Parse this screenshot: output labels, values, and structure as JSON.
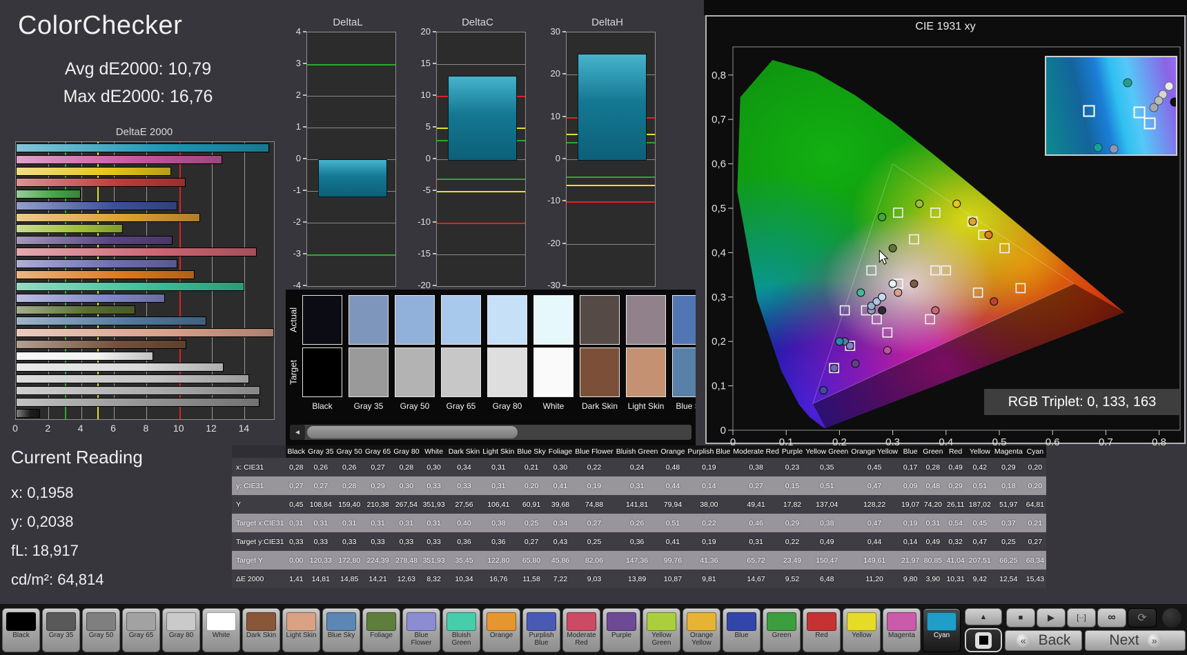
{
  "header": {
    "title": "ColorChecker",
    "avg_label": "Avg dE2000: 10,79",
    "max_label": "Max dE2000: 16,76"
  },
  "current_reading": {
    "title": "Current Reading",
    "x": "x: 0,1958",
    "y": "y: 0,2038",
    "fl": "fL: 18,917",
    "cd": "cd/m²: 64,814"
  },
  "patches": [
    {
      "name": "Black",
      "color": "#000000",
      "bar": "#1c1c1c",
      "dot": "#23232b"
    },
    {
      "name": "Gray 35",
      "color": "#595959",
      "bar": "#8f8f8f",
      "dot": "#8b9db8"
    },
    {
      "name": "Gray 50",
      "color": "#7f7f7f",
      "bar": "#a9a9a9",
      "dot": "#9db4d4"
    },
    {
      "name": "Gray 65",
      "color": "#a2a2a2",
      "bar": "#c2c2c2",
      "dot": "#b0c9e4"
    },
    {
      "name": "Gray 80",
      "color": "#cacaca",
      "bar": "#dbdbdb",
      "dot": "#c8e0f4"
    },
    {
      "name": "White",
      "color": "#ffffff",
      "bar": "#f2f2f2",
      "dot": "#e8f6fa"
    },
    {
      "name": "Dark Skin",
      "color": "#8a5638",
      "bar": "#74503a"
    },
    {
      "name": "Light Skin",
      "color": "#dba183",
      "bar": "#d7a089"
    },
    {
      "name": "Blue Sky",
      "color": "#5c86b4",
      "bar": "#50789c"
    },
    {
      "name": "Foliage",
      "color": "#5e7e3c",
      "bar": "#5a6e32"
    },
    {
      "name": "Blue Flower",
      "color": "#8c8cd2",
      "bar": "#8288c8"
    },
    {
      "name": "Bluish Green",
      "color": "#46ceaa",
      "bar": "#3cbe96"
    },
    {
      "name": "Orange",
      "color": "#e6962e",
      "bar": "#dc781e"
    },
    {
      "name": "Purplish Blue",
      "color": "#4a5ab4",
      "bar": "#6e6eb4"
    },
    {
      "name": "Moderate Red",
      "color": "#cc4a64",
      "bar": "#cc6472"
    },
    {
      "name": "Purple",
      "color": "#6e4a96",
      "bar": "#5a4682"
    },
    {
      "name": "Yellow Green",
      "color": "#aace3c",
      "bar": "#a0be3c"
    },
    {
      "name": "Orange Yellow",
      "color": "#e6b432",
      "bar": "#dc9e32"
    },
    {
      "name": "Blue",
      "color": "#3246aa",
      "bar": "#3c50a0"
    },
    {
      "name": "Green",
      "color": "#3c9e3c",
      "bar": "#46a446"
    },
    {
      "name": "Red",
      "color": "#c63232",
      "bar": "#bc3c3c"
    },
    {
      "name": "Yellow",
      "color": "#e6dc28",
      "bar": "#e6c41e"
    },
    {
      "name": "Magenta",
      "color": "#ca5aaa",
      "bar": "#c4569c"
    },
    {
      "name": "Cyan",
      "color": "#1e9ec8",
      "bar": "#1e96b4"
    }
  ],
  "active_patch": "Cyan",
  "chart_data": [
    {
      "type": "bar",
      "title": "DeltaE 2000",
      "orientation": "horizontal",
      "axis_max": 15.8,
      "x_tick_step": 2,
      "x_tick_max": 14,
      "ref_lines": [
        {
          "value": 3,
          "color": "#2cab2c"
        },
        {
          "value": 5,
          "color": "#e3e32a"
        },
        {
          "value": 10,
          "color": "#e02222"
        }
      ],
      "note": "bars drawn top-to-bottom in reverse patch order (Cyan first, Black last); values from table row dE2000"
    },
    {
      "type": "bar",
      "title": "DeltaL",
      "range": 4,
      "tick_step": 1,
      "bar_from": 0,
      "bar_to": -1.15,
      "ref_lines": [
        {
          "value": 3,
          "color": "#2cab2c"
        },
        {
          "value": -3,
          "color": "#2cab2c"
        }
      ]
    },
    {
      "type": "bar",
      "title": "DeltaC",
      "range": 20,
      "tick_step": 5,
      "bar_from": 0,
      "bar_to": 13.2,
      "ref_lines": [
        {
          "value": 10,
          "color": "#e02222"
        },
        {
          "value": -10,
          "color": "#e02222"
        },
        {
          "value": 5,
          "color": "#e3e32a"
        },
        {
          "value": -5,
          "color": "#e3e32a"
        },
        {
          "value": 3,
          "color": "#2cab2c"
        },
        {
          "value": -3,
          "color": "#2cab2c"
        }
      ]
    },
    {
      "type": "bar",
      "title": "DeltaH",
      "range": 30,
      "tick_step": 10,
      "bar_from": 0,
      "bar_to": 25,
      "ref_lines": [
        {
          "value": 10,
          "color": "#e02222"
        },
        {
          "value": -10,
          "color": "#e02222"
        },
        {
          "value": 6,
          "color": "#e3e32a"
        },
        {
          "value": -6,
          "color": "#e3e32a"
        },
        {
          "value": 4,
          "color": "#2cab2c"
        },
        {
          "value": -4,
          "color": "#2cab2c"
        }
      ]
    }
  ],
  "swatch_viewer": {
    "row_labels": [
      "Actual",
      "Target"
    ],
    "columns": [
      {
        "label": "Black",
        "actual": "#0c0c14",
        "target": "#000000"
      },
      {
        "label": "Gray 35",
        "actual": "#7e96bc",
        "target": "#9a9a9a"
      },
      {
        "label": "Gray 50",
        "actual": "#91b1da",
        "target": "#b3b3b3"
      },
      {
        "label": "Gray 65",
        "actual": "#a8c8ec",
        "target": "#c7c7c7"
      },
      {
        "label": "Gray 80",
        "actual": "#c6e0f8",
        "target": "#dedede"
      },
      {
        "label": "White",
        "actual": "#e6f8fc",
        "target": "#fafafa"
      },
      {
        "label": "Dark Skin",
        "actual": "#564a46",
        "target": "#7c5038"
      },
      {
        "label": "Light Skin",
        "actual": "#91818b",
        "target": "#c49272"
      },
      {
        "label": "Blue Sky",
        "actual": "#5276b4",
        "target": "#5880a8"
      }
    ]
  },
  "cie": {
    "title": "CIE 1931 xy",
    "rgb_triplet": "RGB Triplet: 0, 133, 163",
    "tick_count": 8,
    "cursor_chroma": [
      0.275,
      0.405
    ],
    "inset_squares": [
      [
        0.33,
        0.55
      ],
      [
        0.72,
        0.57
      ],
      [
        0.8,
        0.68
      ]
    ],
    "inset_dots": [
      [
        0.63,
        0.26,
        "#2a9a8a"
      ],
      [
        0.945,
        0.3,
        "#ececec"
      ],
      [
        0.9,
        0.385,
        "#d4d4d4"
      ],
      [
        0.865,
        0.45,
        "#bcbcbc"
      ],
      [
        0.83,
        0.52,
        "#a8a8b2"
      ],
      [
        0.99,
        0.46,
        "#141414"
      ],
      [
        0.4,
        0.93,
        "#18a0a0"
      ],
      [
        0.52,
        0.945,
        "#8898b8"
      ]
    ]
  },
  "table": {
    "rows": [
      {
        "label": "x: CIE31",
        "values": [
          "0,28",
          "0,26",
          "0,26",
          "0,27",
          "0,28",
          "0,30",
          "0,34",
          "0,31",
          "0,21",
          "0,30",
          "0,22",
          "0,24",
          "0,48",
          "0,19",
          "0,38",
          "0,23",
          "0,35",
          "0,45",
          "0,17",
          "0,28",
          "0,49",
          "0,42",
          "0,29",
          "0,20"
        ]
      },
      {
        "label": "y: CIE31",
        "values": [
          "0,27",
          "0,27",
          "0,28",
          "0,29",
          "0,30",
          "0,33",
          "0,33",
          "0,31",
          "0,20",
          "0,41",
          "0,19",
          "0,31",
          "0,44",
          "0,14",
          "0,27",
          "0,15",
          "0,51",
          "0,47",
          "0,09",
          "0,48",
          "0,29",
          "0,51",
          "0,18",
          "0,20"
        ]
      },
      {
        "label": "Y",
        "values": [
          "0,45",
          "108,84",
          "159,40",
          "210,38",
          "267,54",
          "351,93",
          "27,56",
          "106,41",
          "60,91",
          "39,68",
          "74,88",
          "141,81",
          "79,94",
          "38,00",
          "49,41",
          "17,82",
          "137,04",
          "128,22",
          "19,07",
          "74,20",
          "26,11",
          "187,02",
          "51,97",
          "64,81"
        ]
      },
      {
        "label": "Target x:CIE31",
        "values": [
          "0,31",
          "0,31",
          "0,31",
          "0,31",
          "0,31",
          "0,31",
          "0,40",
          "0,38",
          "0,25",
          "0,34",
          "0,27",
          "0,26",
          "0,51",
          "0,22",
          "0,46",
          "0,29",
          "0,38",
          "0,47",
          "0,19",
          "0,31",
          "0,54",
          "0,45",
          "0,37",
          "0,21"
        ]
      },
      {
        "label": "Target y:CIE31",
        "values": [
          "0,33",
          "0,33",
          "0,33",
          "0,33",
          "0,33",
          "0,33",
          "0,36",
          "0,36",
          "0,27",
          "0,43",
          "0,25",
          "0,36",
          "0,41",
          "0,19",
          "0,31",
          "0,22",
          "0,49",
          "0,44",
          "0,14",
          "0,49",
          "0,32",
          "0,47",
          "0,25",
          "0,27"
        ]
      },
      {
        "label": "Target Y",
        "values": [
          "0,00",
          "120,33",
          "172,80",
          "224,39",
          "278,48",
          "351,93",
          "35,45",
          "122,80",
          "65,80",
          "45,86",
          "82,06",
          "147,36",
          "99,76",
          "41,36",
          "65,72",
          "23,49",
          "150,47",
          "149,61",
          "21,97",
          "80,85",
          "41,04",
          "207,51",
          "66,25",
          "68,34"
        ]
      },
      {
        "label": "ΔE 2000",
        "values": [
          "1,41",
          "14,81",
          "14,85",
          "14,21",
          "12,63",
          "8,32",
          "10,34",
          "16,76",
          "11,58",
          "7,22",
          "9,03",
          "13,89",
          "10,87",
          "9,81",
          "14,67",
          "9,52",
          "6,48",
          "11,20",
          "9,80",
          "3,90",
          "10,31",
          "9,42",
          "12,54",
          "15,43"
        ]
      }
    ]
  },
  "toolbar": {
    "back": "Back",
    "next": "Next",
    "icons": {
      "up": "▲",
      "square": "■",
      "stop": "■",
      "play": "▶",
      "marker": "[··]",
      "infinity": "∞",
      "refresh": "⟳",
      "back_arrow": "«",
      "next_arrow": "»",
      "scroll_left": "◄"
    }
  }
}
